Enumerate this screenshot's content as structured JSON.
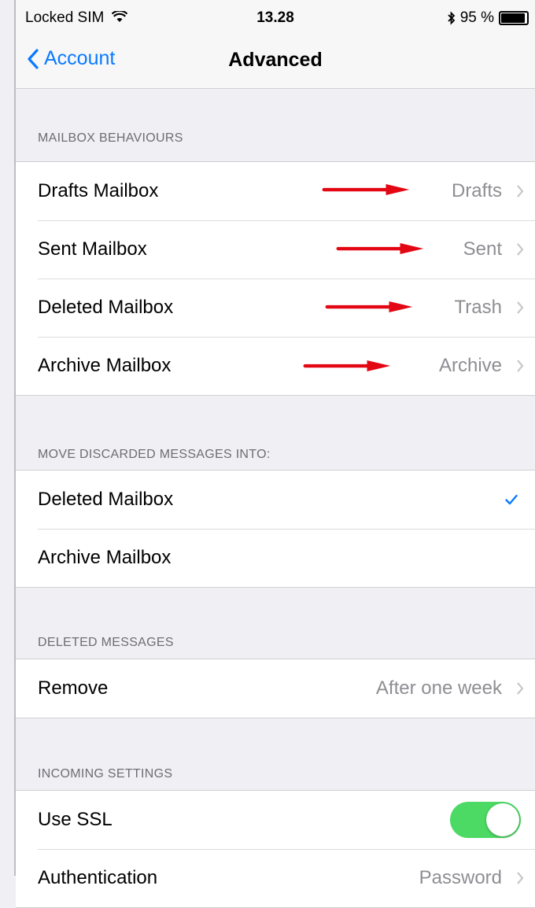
{
  "status_bar": {
    "carrier": "Locked SIM",
    "time": "13.28",
    "battery": "95 %",
    "battery_level": 0.95
  },
  "nav": {
    "back_label": "Account",
    "title": "Advanced"
  },
  "sections": [
    {
      "header": "MAILBOX BEHAVIOURS",
      "rows": [
        {
          "label": "Drafts Mailbox",
          "value": "Drafts"
        },
        {
          "label": "Sent Mailbox",
          "value": "Sent"
        },
        {
          "label": "Deleted Mailbox",
          "value": "Trash"
        },
        {
          "label": "Archive Mailbox",
          "value": "Archive"
        }
      ]
    },
    {
      "header": "MOVE DISCARDED MESSAGES INTO:",
      "rows": [
        {
          "label": "Deleted Mailbox",
          "selected": true
        },
        {
          "label": "Archive Mailbox",
          "selected": false
        }
      ]
    },
    {
      "header": "DELETED MESSAGES",
      "rows": [
        {
          "label": "Remove",
          "value": "After one week"
        }
      ]
    },
    {
      "header": "INCOMING SETTINGS",
      "rows": [
        {
          "label": "Use SSL",
          "toggle": true
        },
        {
          "label": "Authentication",
          "value": "Password"
        }
      ]
    }
  ],
  "colors": {
    "accent": "#0a7aff",
    "toggle_on": "#4cd964",
    "annotation_arrow": "#e30613"
  }
}
